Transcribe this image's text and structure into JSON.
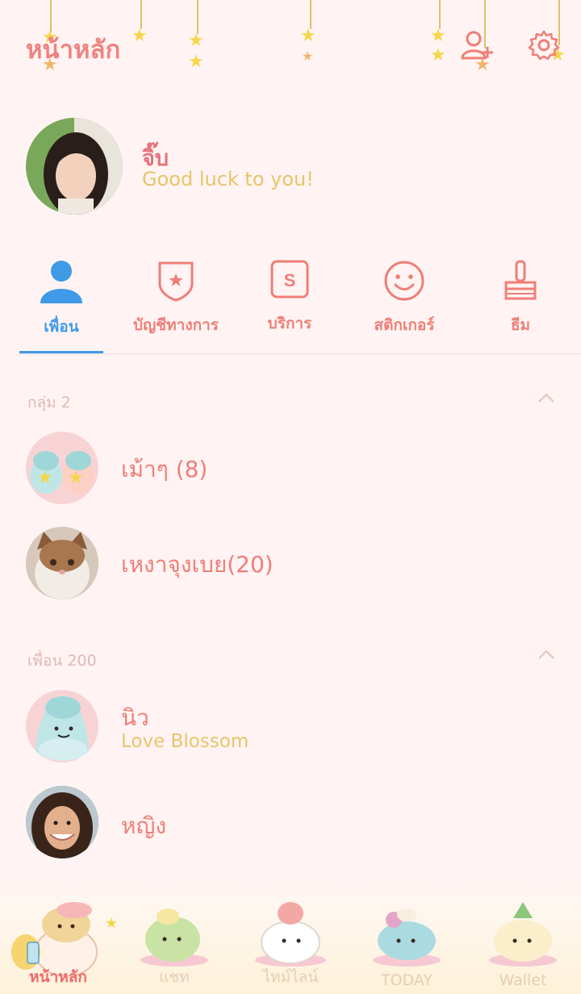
{
  "header": {
    "title": "หน้าหลัก"
  },
  "profile": {
    "name": "จิ๊บ",
    "status": "Good luck to you!"
  },
  "tabs": [
    {
      "label": "เพื่อน"
    },
    {
      "label": "บัญชีทางการ"
    },
    {
      "label": "บริการ"
    },
    {
      "label": "สติกเกอร์"
    },
    {
      "label": "ธีม"
    }
  ],
  "groups_section": {
    "label": "กลุ่ม 2"
  },
  "groups": [
    {
      "name": "เม้าๆ (8)"
    },
    {
      "name": "เหงาจุงเบย(20)"
    }
  ],
  "friends_section": {
    "label": "เพื่อน 200"
  },
  "friends": [
    {
      "name": "นิว",
      "status": "Love Blossom"
    },
    {
      "name": "หญิง"
    }
  ],
  "bottom_nav": [
    {
      "label": "หน้าหลัก"
    },
    {
      "label": "แชท"
    },
    {
      "label": "ไทม์ไลน์"
    },
    {
      "label": "TODAY"
    },
    {
      "label": "Wallet"
    }
  ],
  "colors": {
    "accent": "#ef7e77",
    "active_tab": "#3f9ae8",
    "status": "#e8c46a",
    "background": "#fff4f3"
  }
}
